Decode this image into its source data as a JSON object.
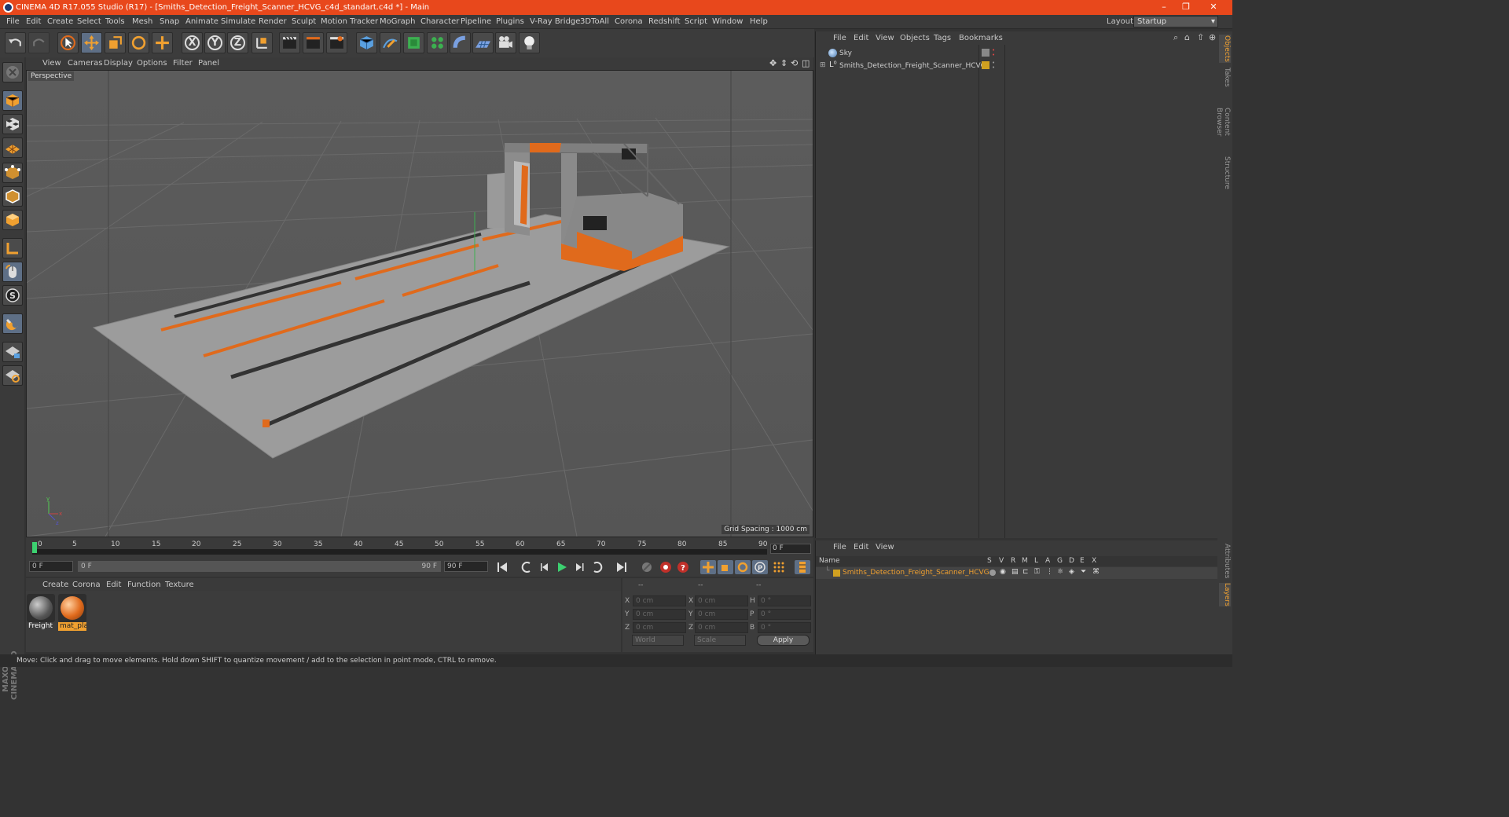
{
  "window": {
    "title": "CINEMA 4D R17.055 Studio (R17) - [Smiths_Detection_Freight_Scanner_HCVG_c4d_standart.c4d *] - Main",
    "min": "–",
    "restore": "❐",
    "close": "✕"
  },
  "menu": [
    "File",
    "Edit",
    "Create",
    "Select",
    "Tools",
    "Mesh",
    "Snap",
    "Animate",
    "Simulate",
    "Render",
    "Sculpt",
    "Motion Tracker",
    "MoGraph",
    "Character",
    "Pipeline",
    "Plugins",
    "V-Ray Bridge",
    "3DToAll",
    "Corona",
    "Redshift",
    "Script",
    "Window",
    "Help"
  ],
  "layout": {
    "label": "Layout:",
    "value": "Startup"
  },
  "toolbar": {
    "x": "X",
    "y": "Y",
    "z": "Z"
  },
  "viewport": {
    "menu": [
      "View",
      "Cameras",
      "Display",
      "Options",
      "Filter",
      "Panel"
    ],
    "label": "Perspective",
    "grid_spacing": "Grid Spacing : 1000 cm"
  },
  "timeline": {
    "ticks": [
      "0",
      "5",
      "10",
      "15",
      "20",
      "25",
      "30",
      "35",
      "40",
      "45",
      "50",
      "55",
      "60",
      "65",
      "70",
      "75",
      "80",
      "85",
      "90"
    ],
    "frame": "0 F",
    "start": "0 F",
    "range_start": "0 F",
    "range_end": "90 F",
    "end": "90 F"
  },
  "materials": {
    "menu": [
      "Create",
      "Corona",
      "Edit",
      "Function",
      "Texture"
    ],
    "items": [
      {
        "name": "Freight"
      },
      {
        "name": "mat_pla"
      }
    ]
  },
  "coords": {
    "headers": [
      "--",
      "--",
      "--"
    ],
    "rows": [
      {
        "a": "X",
        "av": "0 cm",
        "b": "X",
        "bv": "0 cm",
        "c": "H",
        "cv": "0 °"
      },
      {
        "a": "Y",
        "av": "0 cm",
        "b": "Y",
        "bv": "0 cm",
        "c": "P",
        "cv": "0 °"
      },
      {
        "a": "Z",
        "av": "0 cm",
        "b": "Z",
        "bv": "0 cm",
        "c": "B",
        "cv": "0 °"
      }
    ],
    "space": "World",
    "mode": "Scale",
    "apply": "Apply"
  },
  "objects": {
    "menu": [
      "File",
      "Edit",
      "View",
      "Objects",
      "Tags",
      "Bookmarks"
    ],
    "items": [
      {
        "name": "Sky"
      },
      {
        "name": "Smiths_Detection_Freight_Scanner_HCVG"
      }
    ]
  },
  "layers": {
    "menu": [
      "File",
      "Edit",
      "View"
    ],
    "headers": [
      "Name",
      "S",
      "V",
      "R",
      "M",
      "L",
      "A",
      "G",
      "D",
      "E",
      "X"
    ],
    "item": "Smiths_Detection_Freight_Scanner_HCVG"
  },
  "side_tabs": [
    "Objects",
    "Takes",
    "Content Browser",
    "Structure",
    "Attributes",
    "Layers"
  ],
  "status": "Move: Click and drag to move elements. Hold down SHIFT to quantize movement / add to the selection in point mode, CTRL to remove.",
  "branding": "MAXON CINEMA 4D",
  "colors": {
    "title_bar": "#e8481c",
    "accent_orange": "#e06a1c",
    "highlight_blue": "#5e6f86"
  }
}
